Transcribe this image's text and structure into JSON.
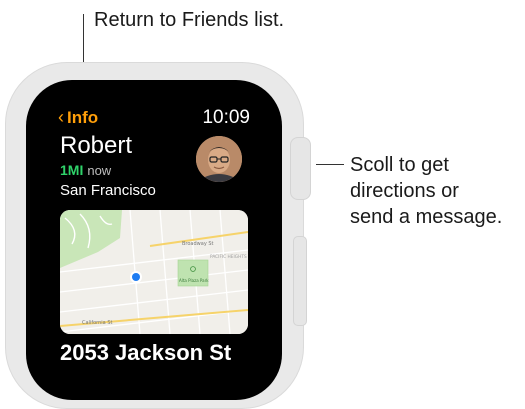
{
  "callouts": {
    "top": "Return to Friends list.",
    "right_lines": [
      "Scoll to get",
      "directions or",
      "send a message."
    ]
  },
  "watch": {
    "nav": {
      "back_label": "Info",
      "back_icon": "chevron-left-icon"
    },
    "time": "10:09",
    "friend": {
      "name": "Robert",
      "distance": "1MI",
      "updated": "now",
      "city": "San Francisco"
    },
    "map": {
      "street_labels": [
        "Broadway St",
        "California St",
        "PACIFIC HEIGHTS",
        "Alta Plaza Park"
      ]
    },
    "address": "2053 Jackson St"
  },
  "colors": {
    "accent": "#ff9f0a",
    "distance": "#2fd36a",
    "location_dot": "#1e7cf2",
    "park": "#bfe3b0"
  }
}
